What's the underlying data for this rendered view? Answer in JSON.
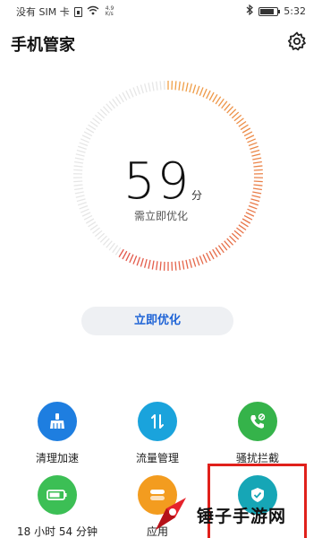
{
  "status_bar": {
    "carrier": "没有 SIM 卡",
    "speed_value": "4.9",
    "speed_unit": "K/s",
    "time": "5:32",
    "battery_level": 0.8,
    "icons": [
      "sim-icon",
      "wifi-icon",
      "bluetooth-icon",
      "battery-icon"
    ]
  },
  "header": {
    "title": "手机管家",
    "settings_icon": "gear-icon"
  },
  "score": {
    "value": "59",
    "unit": "分",
    "hint": "需立即优化",
    "progress": 0.59,
    "colors": {
      "orange": "#f0a247",
      "red": "#e2554a",
      "track": "#e6e6e6"
    }
  },
  "optimize_button": {
    "label": "立即优化"
  },
  "tools": [
    {
      "label": "清理加速",
      "icon": "broom-icon",
      "color": "#1e7ee0"
    },
    {
      "label": "流量管理",
      "icon": "data-arrows-icon",
      "color": "#1aa3dc"
    },
    {
      "label": "骚扰拦截",
      "icon": "phone-block-icon",
      "color": "#35b34a"
    },
    {
      "label": "18 小时 54 分钟",
      "icon": "battery-icon",
      "color": "#3cbf55"
    },
    {
      "label": "应用",
      "icon": "app-icon",
      "color": "#f39c1f"
    },
    {
      "label": "",
      "icon": "shield-icon",
      "color": "#16a6b6"
    }
  ],
  "watermark": {
    "text": "锤子手游网"
  }
}
